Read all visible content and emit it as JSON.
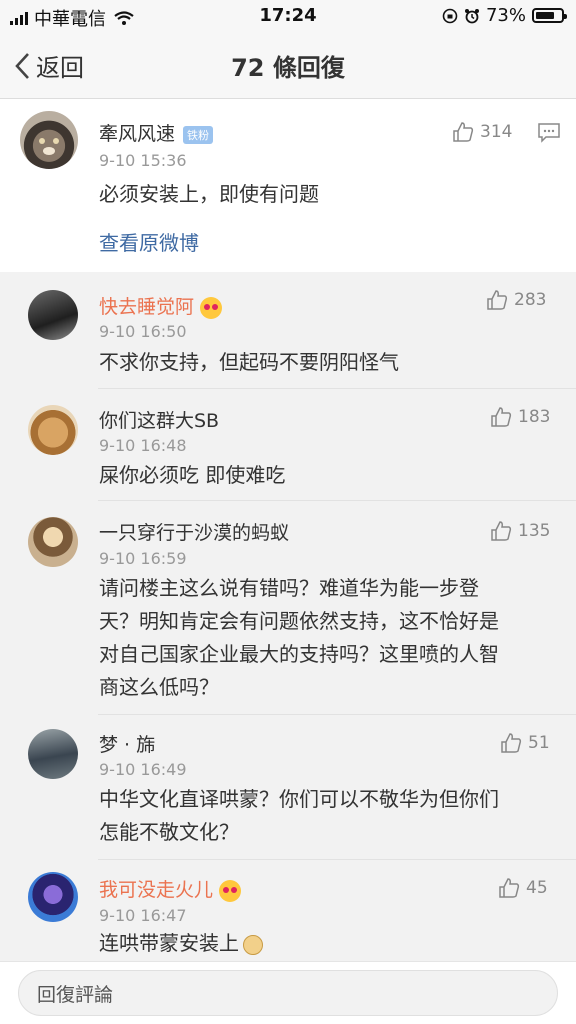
{
  "status": {
    "carrier": "中華電信",
    "time": "17:24",
    "battery": "73%",
    "battery_level": 0.73
  },
  "nav": {
    "back": "返回",
    "title": "72 條回復"
  },
  "post": {
    "username": "牽风风速",
    "badge": "铁粉",
    "time": "9-10 15:36",
    "likes": "314",
    "content": "必须安装上，即使有问题",
    "link": "查看原微博"
  },
  "replies": [
    {
      "username": "快去睡觉阿",
      "time": "9-10 16:50",
      "likes": "283",
      "content": "不求你支持，但起码不要阴阳怪气"
    },
    {
      "username": "你们这群大SB",
      "time": "9-10 16:48",
      "likes": "183",
      "content": "屎你必须吃 即使难吃"
    },
    {
      "username": "一只穿行于沙漠的蚂蚁",
      "time": "9-10 16:59",
      "likes": "135",
      "content": [
        "请问楼主这么说有错吗？难道华为能一步登",
        "天？明知肯定会有问题依然支持，这不恰好是",
        "对自己国家企业最大的支持吗？这里喷的人智",
        "商这么低吗？"
      ]
    },
    {
      "username": "梦 · 旆",
      "time": "9-10 16:49",
      "likes": "51",
      "content": [
        "中华文化直译哄蒙？你们可以不敬华为但你们",
        "怎能不敬文化？"
      ]
    },
    {
      "username": "我可没走火儿",
      "time": "9-10 16:47",
      "likes": "45",
      "content": "连哄带蒙安装上"
    }
  ],
  "composer": {
    "placeholder": "回復評論"
  }
}
